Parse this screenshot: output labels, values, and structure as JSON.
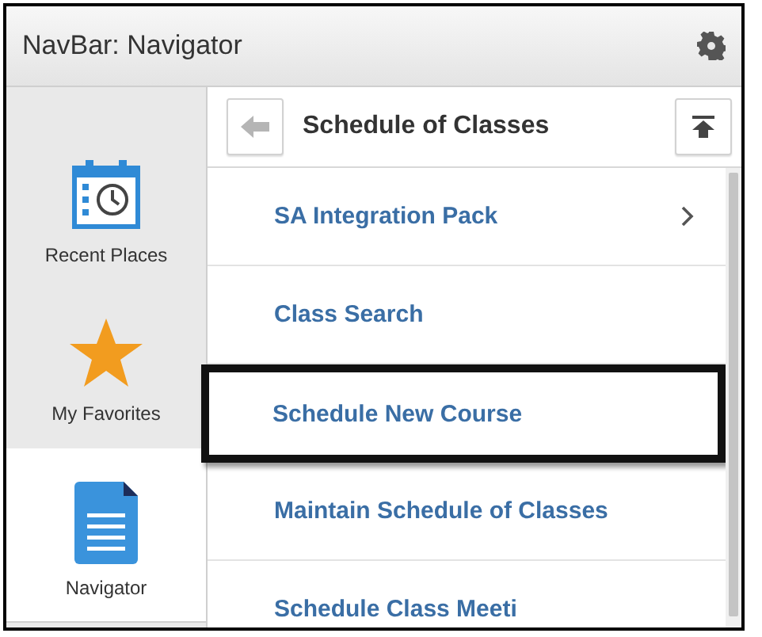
{
  "header": {
    "title": "NavBar: Navigator"
  },
  "sidebar": {
    "items": [
      {
        "label": "Recent Places",
        "kind": "calendar",
        "selected": false
      },
      {
        "label": "My Favorites",
        "kind": "star",
        "selected": false
      },
      {
        "label": "Navigator",
        "kind": "document",
        "selected": true
      }
    ]
  },
  "panel": {
    "title": "Schedule of Classes",
    "items": [
      {
        "label": "SA Integration Pack",
        "has_children": true,
        "highlighted": false
      },
      {
        "label": "Class Search",
        "has_children": false,
        "highlighted": false
      },
      {
        "label": "Schedule New Course",
        "has_children": false,
        "highlighted": true
      },
      {
        "label": "Maintain Schedule of Classes",
        "has_children": false,
        "highlighted": false
      },
      {
        "label": "Schedule Class Meeti",
        "has_children": false,
        "highlighted": false
      }
    ]
  }
}
